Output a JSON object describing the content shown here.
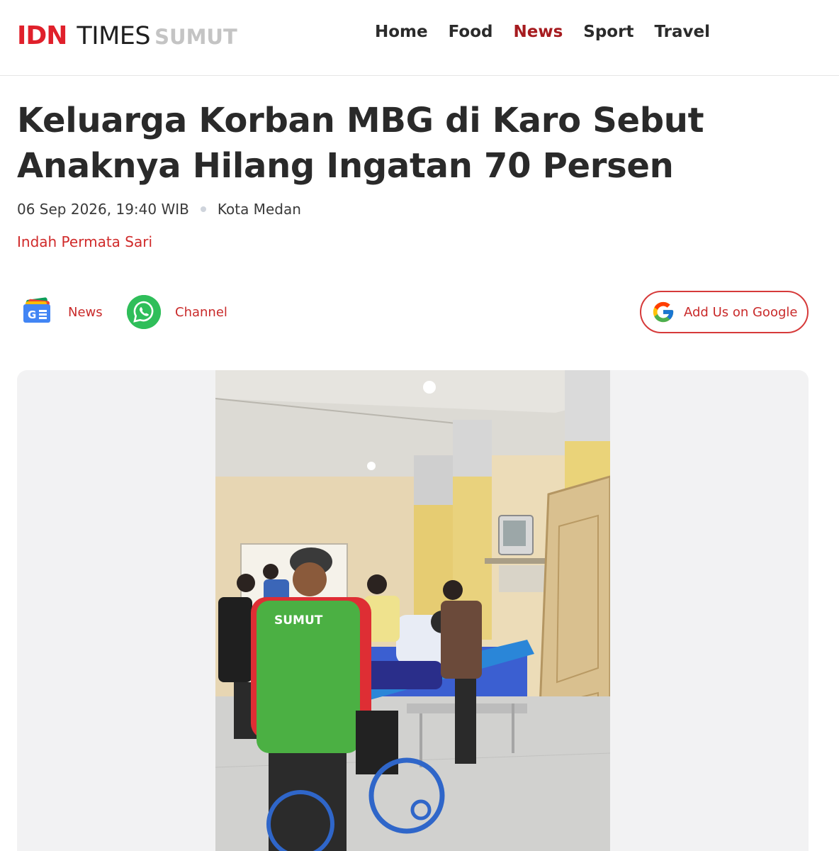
{
  "brand": {
    "name_primary": "IDN",
    "name_secondary": "TIMES",
    "region": "SUMUT",
    "accent_color": "#e0202b",
    "nav_active_color": "#a61b1f"
  },
  "nav": {
    "items": [
      {
        "label": "Home"
      },
      {
        "label": "Food"
      },
      {
        "label": "News"
      },
      {
        "label": "Sport"
      },
      {
        "label": "Travel"
      }
    ],
    "active": "News"
  },
  "article": {
    "title_line1": "Keluarga Korban MBG di Karo Sebut",
    "title_line2": "Anaknya Hilang Ingatan 70 Persen",
    "date": "06 Sep 2026, 19:40 WIB",
    "location": "Kota Medan",
    "author": "Indah Permata Sari"
  },
  "follow": {
    "news_icon": "google-news-icon",
    "news_label": "News",
    "channel_icon": "whatsapp-icon",
    "channel_label": "Channel",
    "google_icon": "google-g-icon",
    "google_label": "Add Us on Google"
  },
  "photo": {
    "vest_text": "SUMUT"
  }
}
